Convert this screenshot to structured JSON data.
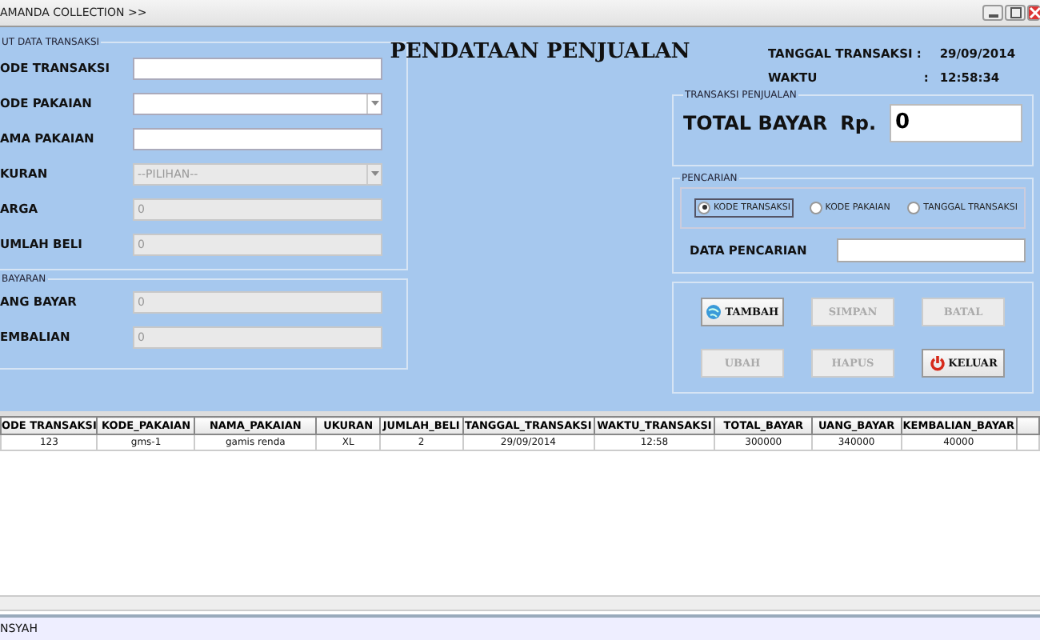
{
  "window": {
    "title": "AMANDA COLLECTION >>"
  },
  "header": {
    "title": "PENDATAAN PENJUALAN",
    "date_label": "TANGGAL TRANSAKSI :",
    "date": "29/09/2014",
    "time_label": "WAKTU",
    "time_sep": ":",
    "time": "12:58:34"
  },
  "input_group": {
    "legend": "UT DATA TRANSAKSI",
    "fields": [
      {
        "label": "ODE TRANSAKSI",
        "kind": "text",
        "disabled": false
      },
      {
        "label": "ODE PAKAIAN",
        "kind": "combo",
        "disabled": false
      },
      {
        "label": "AMA PAKAIAN",
        "kind": "text",
        "disabled": false
      },
      {
        "label": "KURAN",
        "kind": "combo",
        "value": "--PILIHAN--",
        "disabled": true
      },
      {
        "label": "ARGA",
        "kind": "text",
        "value": "0",
        "disabled": true
      },
      {
        "label": "UMLAH BELI",
        "kind": "text",
        "value": "0",
        "disabled": true
      }
    ]
  },
  "payment_group": {
    "legend": "BAYARAN",
    "fields": [
      {
        "label": "ANG BAYAR",
        "kind": "text",
        "value": "0",
        "disabled": true
      },
      {
        "label": "EMBALIAN",
        "kind": "text",
        "value": "0",
        "disabled": true
      }
    ]
  },
  "total_group": {
    "legend": "TRANSAKSI PENJUALAN",
    "label": "TOTAL BAYAR",
    "currency": "Rp.",
    "value": "0"
  },
  "search_group": {
    "legend": "PENCARIAN",
    "options": [
      {
        "label": "KODE TRANSAKSI",
        "selected": true
      },
      {
        "label": "KODE PAKAIAN",
        "selected": false
      },
      {
        "label": "TANGGAL TRANSAKSI",
        "selected": false
      }
    ],
    "label": "DATA PENCARIAN"
  },
  "buttons": [
    {
      "label": "TAMBAH",
      "disabled": false
    },
    {
      "label": "SIMPAN",
      "disabled": true
    },
    {
      "label": "BATAL",
      "disabled": true
    },
    {
      "label": "UBAH",
      "disabled": true
    },
    {
      "label": "HAPUS",
      "disabled": true
    },
    {
      "label": "KELUAR",
      "disabled": false
    }
  ],
  "table": {
    "columns": [
      "ODE TRANSAKSI",
      "KODE_PAKAIAN",
      "NAMA_PAKAIAN",
      "UKURAN",
      "JUMLAH_BELI",
      "TANGGAL_TRANSAKSI",
      "WAKTU_TRANSAKSI",
      "TOTAL_BAYAR",
      "UANG_BAYAR",
      "KEMBALIAN_BAYAR"
    ],
    "rows": [
      [
        "123",
        "gms-1",
        "gamis renda",
        "XL",
        "2",
        "29/09/2014",
        "12:58",
        "300000",
        "340000",
        "40000"
      ]
    ]
  },
  "status_bar": {
    "text": "NSYAH"
  }
}
